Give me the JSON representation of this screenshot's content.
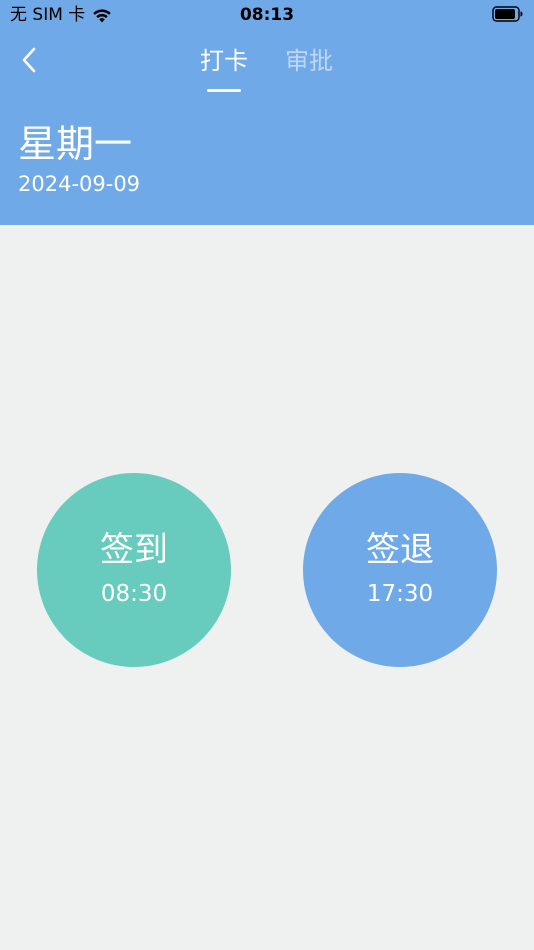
{
  "status_bar": {
    "carrier": "无 SIM 卡",
    "time": "08:13"
  },
  "nav": {
    "back_icon": "chevron-left-icon",
    "tabs": [
      {
        "label": "打卡",
        "active": true
      },
      {
        "label": "审批",
        "active": false
      }
    ]
  },
  "date_info": {
    "weekday": "星期一",
    "date": "2024-09-09"
  },
  "punch": {
    "check_in": {
      "label": "签到",
      "time": "08:30",
      "color": "#67cbbd"
    },
    "check_out": {
      "label": "签退",
      "time": "17:30",
      "color": "#70a9e7"
    }
  },
  "colors": {
    "header": "#70a9e7",
    "background": "#eff0f0"
  }
}
